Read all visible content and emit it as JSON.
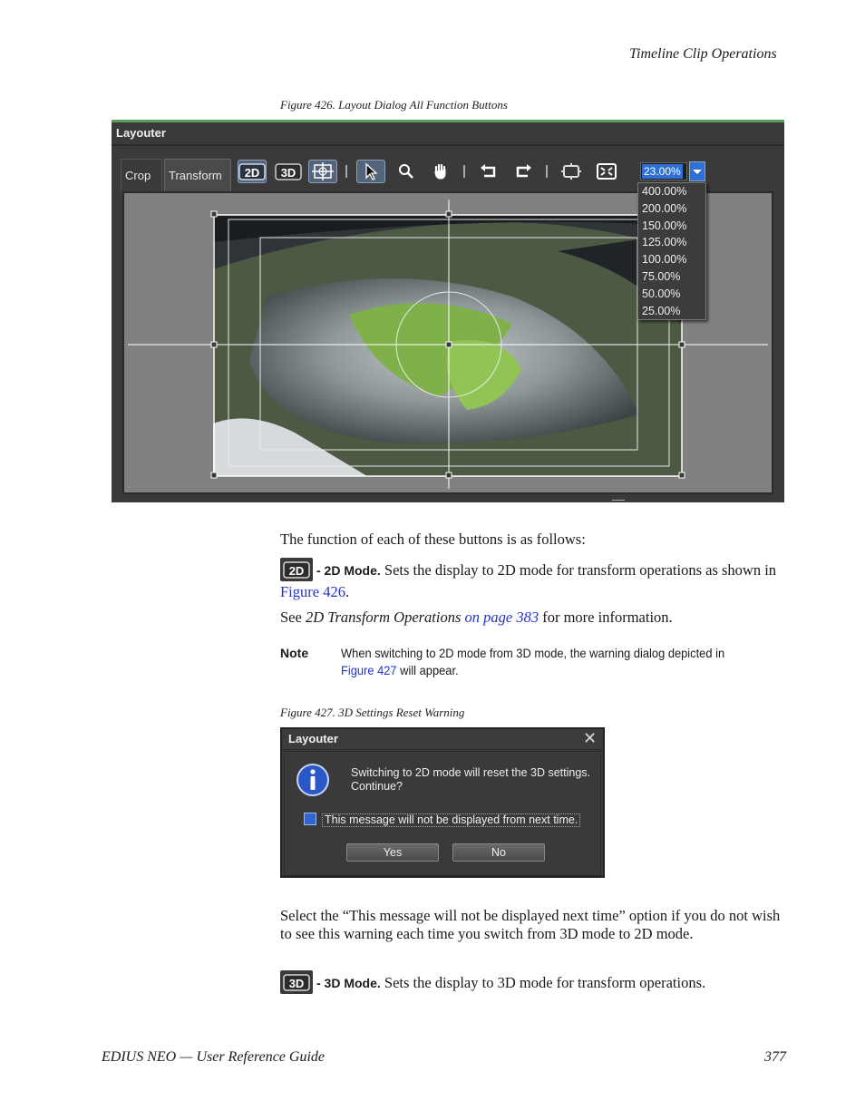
{
  "header": {
    "section_title": "Timeline Clip Operations"
  },
  "figure426": {
    "caption": "Figure 426.  Layout Dialog All Function Buttons",
    "window_title": "Layouter",
    "tabs": [
      "Crop",
      "Transform"
    ],
    "toolbar_icons": [
      "2d-mode-icon",
      "3d-mode-icon",
      "grid-icon",
      "select-arrow-icon",
      "zoom-magnifier-icon",
      "hand-pan-icon",
      "undo-icon",
      "redo-icon",
      "fit-frame-icon",
      "fit-window-icon"
    ],
    "zoom": {
      "value": "23.00%",
      "options": [
        "400.00%",
        "200.00%",
        "150.00%",
        "125.00%",
        "100.00%",
        "75.00%",
        "50.00%",
        "25.00%"
      ]
    }
  },
  "intro_text": "The function of each of these buttons is as follows:",
  "mode2d": {
    "label": "- 2D Mode.",
    "text_a": " Sets the display to 2D mode for transform operations as shown in ",
    "link": "Figure 426",
    "text_b": "."
  },
  "see_also": {
    "prefix": "See ",
    "title": "2D Transform Operations",
    "link": "on page 383",
    "suffix": " for more information."
  },
  "note": {
    "label": "Note",
    "text_a": "When switching to 2D mode from 3D mode, the warning dialog depicted in",
    "link": "Figure 427",
    "text_b": " will appear."
  },
  "figure427": {
    "caption": "Figure 427.  3D Settings Reset Warning",
    "window_title": "Layouter",
    "message_line1": "Switching to 2D mode will reset the 3D settings.",
    "message_line2": "Continue?",
    "checkbox_label": "This message will not be displayed from next time.",
    "yes": "Yes",
    "no": "No"
  },
  "select_text": "Select the “This message will not be displayed next time” option if you do not wish to see this warning each time you switch from 3D mode to 2D mode.",
  "mode3d": {
    "label": "- 3D Mode.",
    "text": " Sets the display to 3D mode for transform operations."
  },
  "footer": {
    "guide": "EDIUS NEO  —  User Reference Guide",
    "page": "377"
  }
}
